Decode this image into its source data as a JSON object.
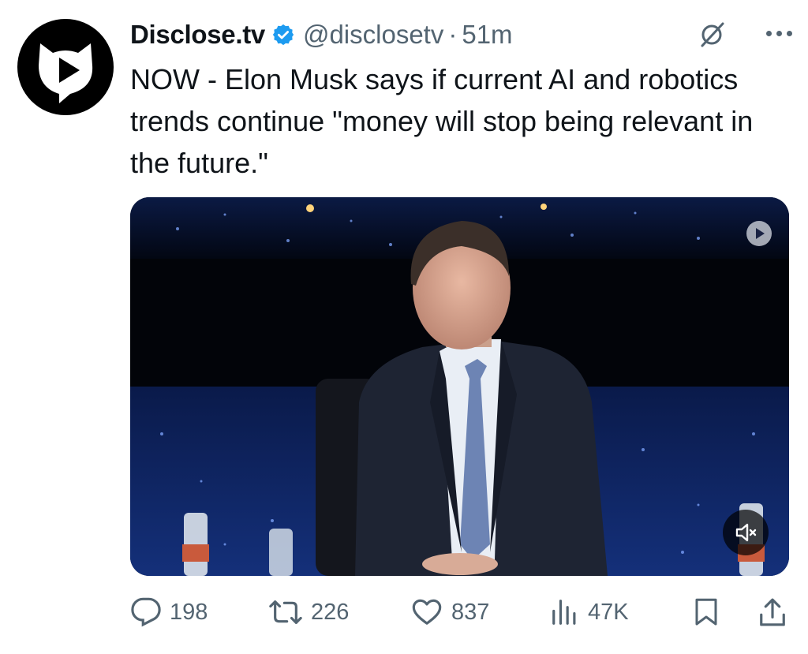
{
  "account": {
    "name": "Disclose.tv",
    "handle": "@disclosetv",
    "separator": "·",
    "time": "51m"
  },
  "tweet": {
    "text": "NOW - Elon Musk says if current AI and robotics trends continue \"money will stop being relevant in the future.\""
  },
  "metrics": {
    "replies": "198",
    "reposts": "226",
    "likes": "837",
    "views": "47K"
  },
  "icons": {
    "avatar": "disclose-play-logo-icon",
    "verified": "verified-badge-icon",
    "grok": "grok-icon",
    "more": "more-options-icon",
    "reply": "reply-icon",
    "repost": "repost-icon",
    "like": "heart-icon",
    "views": "views-icon",
    "bookmark": "bookmark-icon",
    "share": "share-icon",
    "mute": "muted-speaker-icon"
  },
  "colors": {
    "text": "#0f1419",
    "secondary": "#536471",
    "verified": "#1d9bf0"
  }
}
